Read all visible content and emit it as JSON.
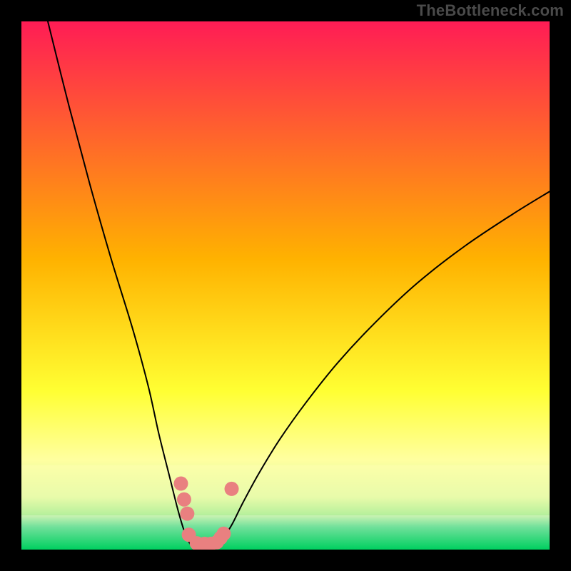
{
  "attribution": "TheBottleneck.com",
  "chart_data": {
    "type": "line",
    "title": "",
    "xlabel": "",
    "ylabel": "",
    "xlim": [
      0,
      100
    ],
    "ylim": [
      0,
      100
    ],
    "grid": false,
    "legend": false,
    "background_gradient": {
      "stops": [
        {
          "pos": 0.0,
          "color": "#ff1c55"
        },
        {
          "pos": 0.45,
          "color": "#ffb200"
        },
        {
          "pos": 0.7,
          "color": "#ffff33"
        },
        {
          "pos": 0.83,
          "color": "#ffffa0"
        },
        {
          "pos": 0.9,
          "color": "#cdf6a2"
        },
        {
          "pos": 0.94,
          "color": "#4dd97d"
        },
        {
          "pos": 1.0,
          "color": "#00d060"
        }
      ]
    },
    "series": [
      {
        "name": "left-curve",
        "color": "#000000",
        "x": [
          5,
          9,
          13,
          17,
          21,
          24,
          26,
          28,
          29.5,
          30.5,
          31.3,
          32,
          32.7
        ],
        "y": [
          100,
          84,
          69,
          55,
          42,
          31,
          22,
          14,
          8,
          4.5,
          2.3,
          1.0,
          0.3
        ]
      },
      {
        "name": "right-curve",
        "color": "#000000",
        "x": [
          37,
          37.7,
          38.5,
          40,
          42,
          45,
          49,
          54,
          60,
          67,
          75,
          84,
          93,
          100
        ],
        "y": [
          0.3,
          1.0,
          2.5,
          5,
          9,
          14.5,
          21,
          28,
          35.5,
          43,
          50.5,
          57.5,
          63.5,
          67.8
        ]
      }
    ],
    "green_band": {
      "y0": 0,
      "y1": 6.5
    },
    "pale_band": {
      "y0": 6.5,
      "y1": 16
    },
    "markers": {
      "name": "bottleneck-points",
      "color": "#e98080",
      "radius": 10,
      "points": [
        {
          "x": 30.2,
          "y": 12.5
        },
        {
          "x": 30.8,
          "y": 9.5
        },
        {
          "x": 31.4,
          "y": 6.8
        },
        {
          "x": 31.7,
          "y": 2.8
        },
        {
          "x": 33.2,
          "y": 1.2
        },
        {
          "x": 34.7,
          "y": 1.1
        },
        {
          "x": 35.9,
          "y": 1.1
        },
        {
          "x": 37.0,
          "y": 1.4
        },
        {
          "x": 37.7,
          "y": 2.2
        },
        {
          "x": 38.3,
          "y": 3.0
        },
        {
          "x": 39.8,
          "y": 11.5
        }
      ]
    }
  }
}
